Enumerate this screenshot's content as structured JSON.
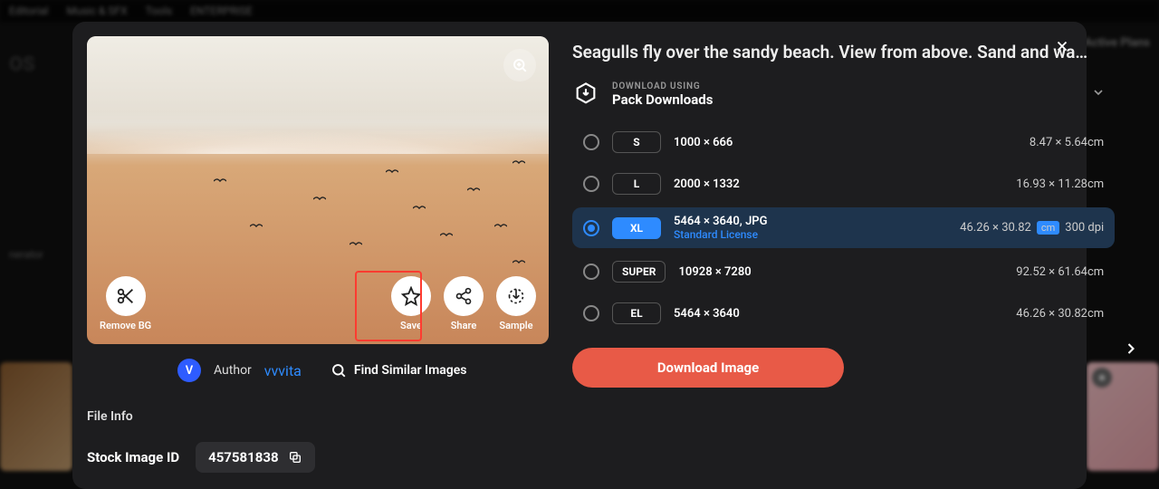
{
  "nav": {
    "items": [
      "Editorial",
      "Music & SFX",
      "Tools",
      "ENTERPRISE"
    ]
  },
  "brand": "OS",
  "sidebar_link": "nerator",
  "bg_right_link": "Active Plans",
  "modal": {
    "title": "Seagulls fly over the sandy beach. View from above. Sand and wa…",
    "actions": {
      "remove_bg": "Remove BG",
      "save": "Save",
      "share": "Share",
      "sample": "Sample"
    },
    "author_label": "Author",
    "author_name": "vvvita",
    "author_initial": "V",
    "find_similar": "Find Similar Images",
    "file_info_label": "File Info",
    "stock_id_label": "Stock Image ID",
    "stock_id": "457581838",
    "download_using_small": "DOWNLOAD USING",
    "download_using_big": "Pack Downloads",
    "sizes": [
      {
        "code": "S",
        "dims": "1000 × 666",
        "print": "8.47 × 5.64cm"
      },
      {
        "code": "L",
        "dims": "2000 × 1332",
        "print": "16.93 × 11.28cm"
      },
      {
        "code": "XL",
        "dims": "5464 × 3640, JPG",
        "license": "Standard License",
        "print": "46.26 × 30.82",
        "unit": "cm",
        "dpi": "300 dpi",
        "selected": true
      },
      {
        "code": "SUPER",
        "dims": "10928 × 7280",
        "print": "92.52 × 61.64cm"
      },
      {
        "code": "EL",
        "dims": "5464 × 3640",
        "print": "46.26 × 30.82cm"
      }
    ],
    "download_button": "Download Image"
  }
}
